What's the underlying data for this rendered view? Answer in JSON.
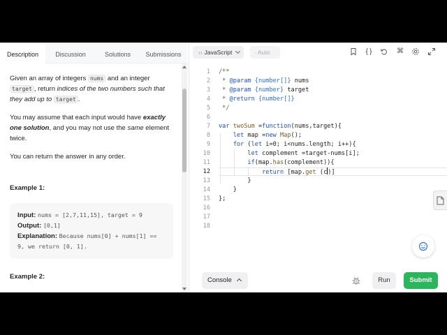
{
  "tabs": [
    "Description",
    "Discussion",
    "Solutions",
    "Submissions"
  ],
  "description": {
    "p1_a": "Given an array of integers ",
    "p1_code1": "nums",
    "p1_b": " and an integer ",
    "p1_code2": "target",
    "p1_c": ", return ",
    "p1_italic": "indices of the two numbers such that they add up to ",
    "p1_code3": "target",
    "p1_d": ".",
    "p2_a": "You may assume that each input would have ",
    "p2_bold": "exactly one solution",
    "p2_b": ", and you may not use the ",
    "p2_italic": "same",
    "p2_c": " element twice.",
    "p3": "You can return the answer in any order.",
    "example1_title": "Example 1:",
    "example1": {
      "input_label": "Input:",
      "input_value": "nums = [2,7,11,15], target = 9",
      "output_label": "Output:",
      "output_value": "[0,1]",
      "explanation_label": "Explanation:",
      "explanation_value": "Because nums[0] + nums[1] == 9, we return [0, 1]."
    },
    "example2_title": "Example 2:"
  },
  "toolbar": {
    "language": "JavaScript",
    "mode": "Auto"
  },
  "code_lines": [
    "/**",
    " * @param {number[]} nums",
    " * @param {number} target",
    " * @return {number[]}",
    " */",
    "",
    "var twoSum =function(nums,target){",
    "    let map =new Map();",
    "    for (let i=0; i<nums.length; i++){",
    "        let complement =target-nums[i];",
    "        if(map.has(complement)){",
    "            return [map.get (c)]",
    "        }",
    "    }",
    "};",
    "",
    "",
    ""
  ],
  "line_numbers": [
    "1",
    "2",
    "3",
    "4",
    "5",
    "6",
    "7",
    "8",
    "9",
    "10",
    "11",
    "12",
    "13",
    "14",
    "15",
    "16",
    "17",
    "18"
  ],
  "current_line": 12,
  "bottom": {
    "console_label": "Console",
    "run_label": "Run",
    "submit_label": "Submit"
  },
  "colors": {
    "submit": "#2db55d",
    "doc_type": "#2a6fdb",
    "keyword": "#1f4fbf"
  },
  "icons": [
    "code-braces-icon",
    "bookmark-icon",
    "reset-icon",
    "command-icon",
    "settings-icon",
    "expand-icon",
    "debug-icon",
    "chat-icon",
    "note-icon"
  ]
}
